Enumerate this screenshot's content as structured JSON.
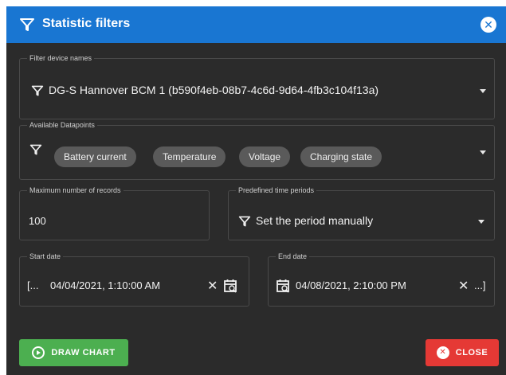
{
  "dialog": {
    "title": "Statistic filters",
    "colors": {
      "titlebar": "#1976d2",
      "background": "#2b2b2b",
      "green": "#4caf50",
      "red": "#e53935"
    }
  },
  "device_filter": {
    "legend": "Filter device names",
    "value": "DG-S Hannover BCM 1 (b590f4eb-08b7-4c6d-9d64-4fb3c104f13a)"
  },
  "datapoints": {
    "legend": "Available Datapoints",
    "chips": [
      "Battery current",
      "Temperature",
      "Voltage",
      "Charging state"
    ]
  },
  "max_records": {
    "legend": "Maximum number of records",
    "value": "100"
  },
  "time_periods": {
    "legend": "Predefined time periods",
    "value": "Set the period manually"
  },
  "start_date": {
    "legend": "Start date",
    "prefix": "[...",
    "value": "04/04/2021, 1:10:00 AM"
  },
  "end_date": {
    "legend": "End date",
    "value": "04/08/2021, 2:10:00 PM",
    "suffix": "...]"
  },
  "buttons": {
    "draw_chart": "DRAW CHART",
    "close": "CLOSE"
  }
}
